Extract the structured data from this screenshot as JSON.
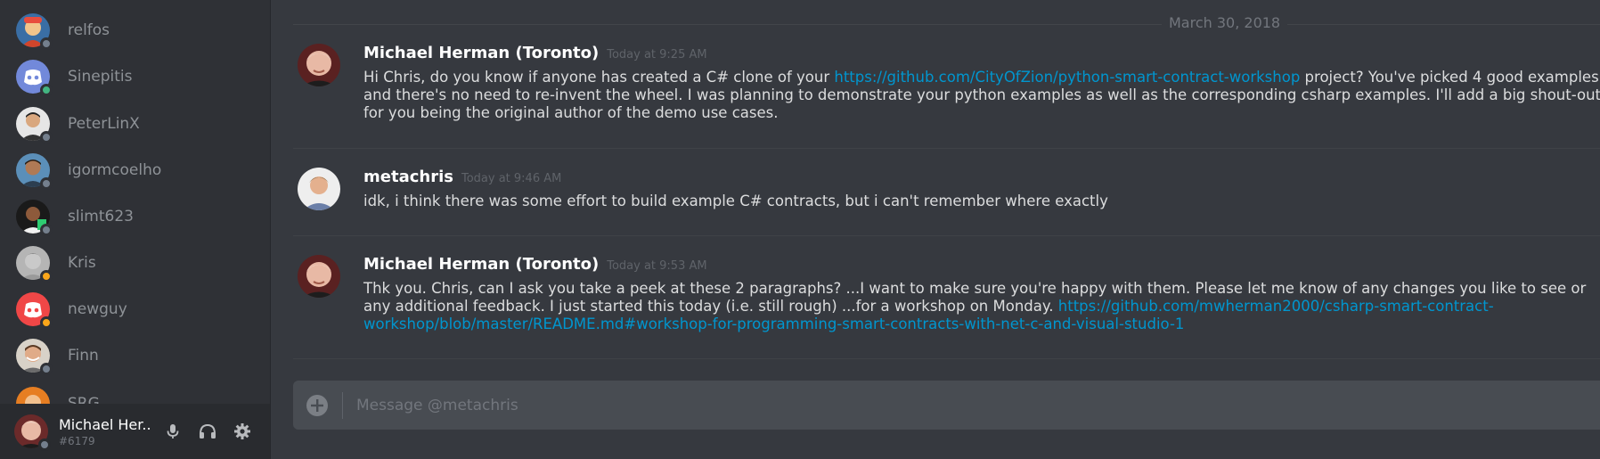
{
  "sidebar": {
    "members": [
      {
        "name": "relfos",
        "status": "offline"
      },
      {
        "name": "Sinepitis",
        "status": "online"
      },
      {
        "name": "PeterLinX",
        "status": "offline"
      },
      {
        "name": "igormcoelho",
        "status": "offline"
      },
      {
        "name": "slimt623",
        "status": "offline"
      },
      {
        "name": "Kris",
        "status": "idle"
      },
      {
        "name": "newguy",
        "status": "idle"
      },
      {
        "name": "Finn",
        "status": "offline"
      },
      {
        "name": "SRG",
        "status": "offline"
      }
    ]
  },
  "userbar": {
    "name": "Michael Her...",
    "tag": "#6179",
    "mic_icon": "microphone-icon",
    "headset_icon": "headphones-icon",
    "settings_icon": "gear-icon"
  },
  "chat": {
    "date_divider": "March 30, 2018",
    "messages": [
      {
        "author": "Michael Herman (Toronto)",
        "timestamp": "Today at 9:25 AM",
        "text_before": "Hi Chris, do you know if anyone has created a C# clone of your ",
        "link": "https://github.com/CityOfZion/python-smart-contract-workshop",
        "text_after": " project?  You've picked 4 good examples and there's no need to re-invent the wheel.  I was planning to demonstrate your python examples as well as the corresponding csharp examples.  I'll add a big shout-out for you being the original author of the demo use cases."
      },
      {
        "author": "metachris",
        "timestamp": "Today at 9:46 AM",
        "text_before": "idk, i think there was some effort to build example C# contracts, but i can't remember where exactly",
        "link": "",
        "text_after": ""
      },
      {
        "author": "Michael Herman (Toronto)",
        "timestamp": "Today at 9:53 AM",
        "text_before": "Thk you.  Chris, can I ask you take a peek at these 2 paragraphs? ...I want to make sure you're happy with them.  Please let me know of any changes you like to see or any additional feedback.  I just started this today (i.e. still rough) ...for a workshop on Monday. ",
        "link": "https://github.com/mwherman2000/csharp-smart-contract-workshop/blob/master/README.md#workshop-for-programming-smart-contracts-with-net-c-and-visual-studio-1",
        "text_after": ""
      }
    ],
    "input": {
      "placeholder": "Message @metachris",
      "value": ""
    }
  }
}
